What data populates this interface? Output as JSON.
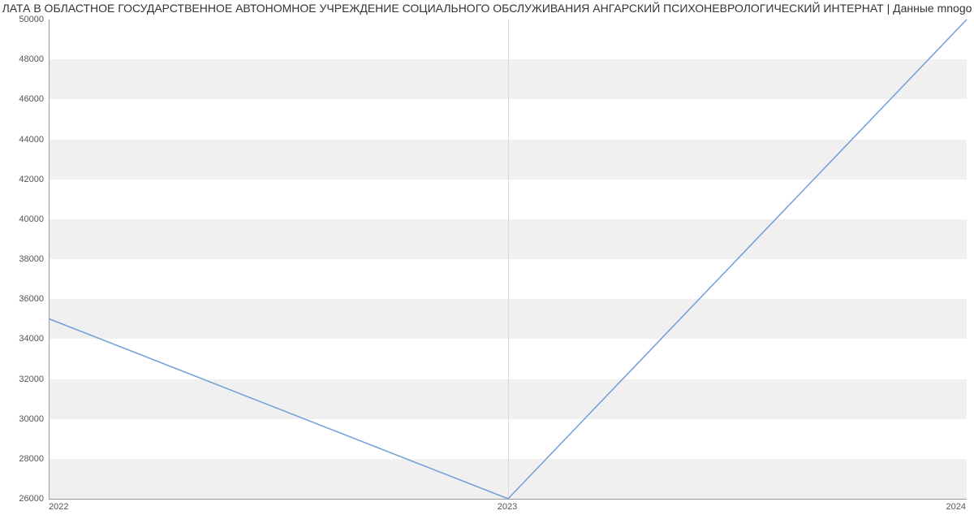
{
  "chart_data": {
    "type": "line",
    "title": "ЛАТА В ОБЛАСТНОЕ ГОСУДАРСТВЕННОЕ АВТОНОМНОЕ УЧРЕЖДЕНИЕ СОЦИАЛЬНОГО ОБСЛУЖИВАНИЯ АНГАРСКИЙ ПСИХОНЕВРОЛОГИЧЕСКИЙ ИНТЕРНАТ | Данные mnogo",
    "x": [
      2022,
      2023,
      2024
    ],
    "values": [
      35000,
      26000,
      50000
    ],
    "xticks": [
      2022,
      2023,
      2024
    ],
    "yticks": [
      26000,
      28000,
      30000,
      32000,
      34000,
      36000,
      38000,
      40000,
      42000,
      44000,
      46000,
      48000,
      50000
    ],
    "xlim": [
      2022,
      2024
    ],
    "ylim": [
      26000,
      50000
    ],
    "line_color": "#6f9fd8",
    "band_color": "#f0f0f0"
  }
}
